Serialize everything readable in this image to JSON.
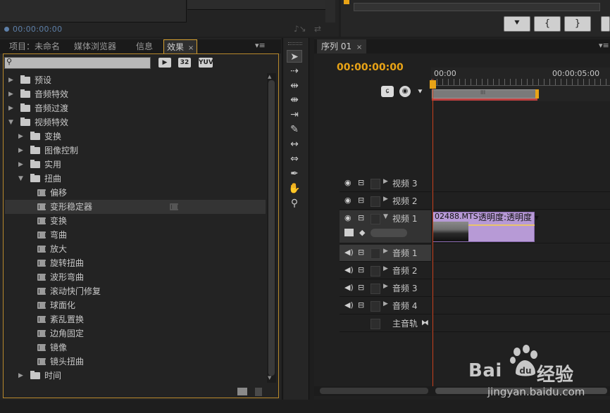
{
  "top": {
    "timecode": "00:00:00:00",
    "transport_buttons": [
      "⯆",
      "{",
      "}"
    ]
  },
  "effects_panel": {
    "tabs": [
      {
        "label": "项目：未命名",
        "active": false
      },
      {
        "label": "媒体浏览器",
        "active": false
      },
      {
        "label": "信息",
        "active": false
      },
      {
        "label": "效果",
        "active": true,
        "close": "×"
      }
    ],
    "menu_icon": "▾≡",
    "search": {
      "value": "",
      "placeholder": ""
    },
    "badges": [
      "32",
      "YUV"
    ],
    "tree": [
      {
        "label": "预设",
        "level": 0,
        "type": "folder-star",
        "expanded": false
      },
      {
        "label": "音频特效",
        "level": 0,
        "type": "folder",
        "expanded": false
      },
      {
        "label": "音频过渡",
        "level": 0,
        "type": "folder",
        "expanded": false
      },
      {
        "label": "视频特效",
        "level": 0,
        "type": "folder",
        "expanded": true
      },
      {
        "label": "变换",
        "level": 1,
        "type": "folder",
        "expanded": false
      },
      {
        "label": "图像控制",
        "level": 1,
        "type": "folder",
        "expanded": false
      },
      {
        "label": "实用",
        "level": 1,
        "type": "folder",
        "expanded": false
      },
      {
        "label": "扭曲",
        "level": 1,
        "type": "folder",
        "expanded": true
      },
      {
        "label": "偏移",
        "level": 2,
        "type": "effect"
      },
      {
        "label": "变形稳定器",
        "level": 2,
        "type": "effect",
        "selected": true,
        "accelerated": true
      },
      {
        "label": "变换",
        "level": 2,
        "type": "effect"
      },
      {
        "label": "弯曲",
        "level": 2,
        "type": "effect"
      },
      {
        "label": "放大",
        "level": 2,
        "type": "effect"
      },
      {
        "label": "旋转扭曲",
        "level": 2,
        "type": "effect"
      },
      {
        "label": "波形弯曲",
        "level": 2,
        "type": "effect"
      },
      {
        "label": "滚动快门修复",
        "level": 2,
        "type": "effect"
      },
      {
        "label": "球面化",
        "level": 2,
        "type": "effect"
      },
      {
        "label": "紊乱置换",
        "level": 2,
        "type": "effect"
      },
      {
        "label": "边角固定",
        "level": 2,
        "type": "effect"
      },
      {
        "label": "镜像",
        "level": 2,
        "type": "effect"
      },
      {
        "label": "镜头扭曲",
        "level": 2,
        "type": "effect"
      },
      {
        "label": "时间",
        "level": 1,
        "type": "folder",
        "expanded": false
      }
    ]
  },
  "tools": [
    "selection-tool",
    "track-select-tool",
    "ripple-edit-tool",
    "rolling-edit-tool",
    "rate-stretch-tool",
    "razor-tool",
    "slip-tool",
    "slide-tool",
    "pen-tool",
    "hand-tool",
    "zoom-tool"
  ],
  "tool_glyphs": [
    "➤",
    "⇢",
    "⇹",
    "⇼",
    "⇥",
    "✎",
    "↔",
    "⇔",
    "✒",
    "✋",
    "⚲"
  ],
  "sequence": {
    "tab_label": "序列 01",
    "tab_close": "×",
    "timecode": "00:00:00:00",
    "ruler_labels": [
      "00:00",
      "00:00:05:00"
    ],
    "work_area_label": "III",
    "tracks": [
      {
        "name": "视频 3",
        "kind": "video"
      },
      {
        "name": "视频 2",
        "kind": "video"
      },
      {
        "name": "视频 1",
        "kind": "video",
        "expanded": true
      },
      {
        "name": "音频 1",
        "kind": "audio",
        "active": true
      },
      {
        "name": "音频 2",
        "kind": "audio"
      },
      {
        "name": "音频 3",
        "kind": "audio"
      },
      {
        "name": "音频 4",
        "kind": "audio"
      },
      {
        "name": "主音轨",
        "kind": "master"
      }
    ],
    "clip": {
      "name": "02488.MTS",
      "fx": "透明度:透明度 ▾",
      "color": "#b79ad6"
    }
  },
  "colors": {
    "accent": "#e8a316",
    "playhead": "#c8401c",
    "panel_border": "#b8892c"
  },
  "watermark": {
    "text": "Bai",
    "text2": "经验",
    "url": "jingyan.baidu.com"
  }
}
